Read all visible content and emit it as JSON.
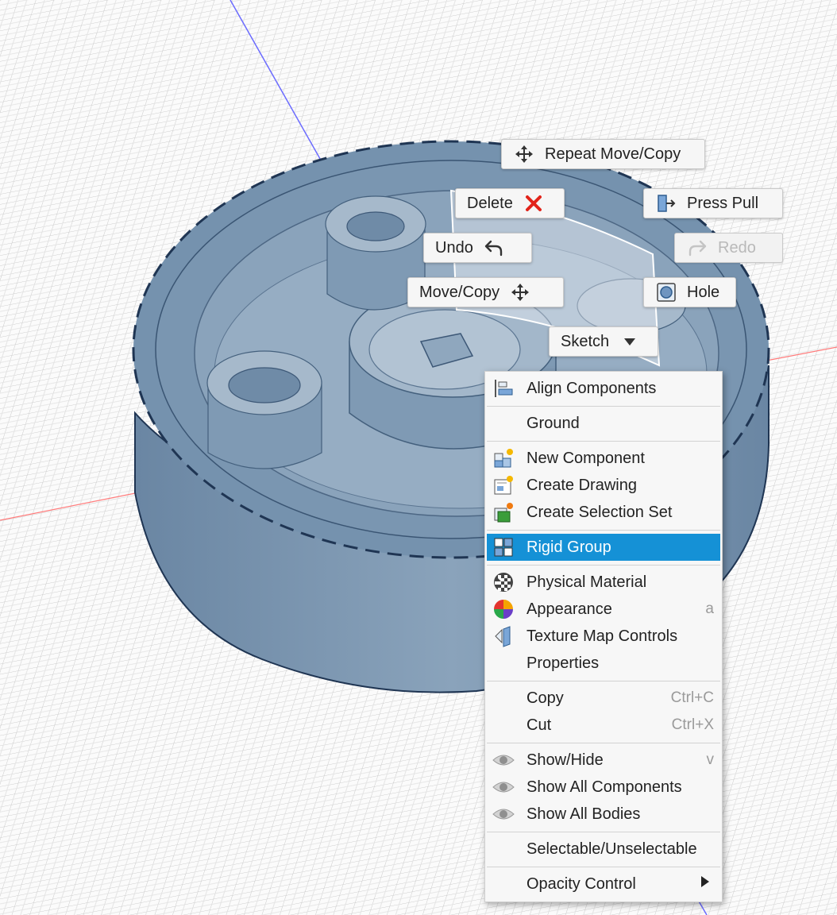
{
  "marking_menu": {
    "repeat_move_copy": "Repeat Move/Copy",
    "delete": "Delete",
    "press_pull": "Press Pull",
    "undo": "Undo",
    "redo": "Redo",
    "move_copy": "Move/Copy",
    "hole": "Hole",
    "sketch": "Sketch"
  },
  "context_menu": {
    "items": [
      {
        "label": "Align Components",
        "icon": "align-components-icon"
      },
      {
        "label": "Ground"
      },
      {
        "label": "New Component",
        "icon": "new-component-icon"
      },
      {
        "label": "Create Drawing",
        "icon": "create-drawing-icon"
      },
      {
        "label": "Create Selection Set",
        "icon": "selection-set-icon"
      },
      {
        "label": "Rigid Group",
        "icon": "rigid-group-icon",
        "highlighted": true
      },
      {
        "label": "Physical Material",
        "icon": "physical-material-icon"
      },
      {
        "label": "Appearance",
        "icon": "appearance-icon",
        "shortcut": "a"
      },
      {
        "label": "Texture Map Controls",
        "icon": "texture-map-icon"
      },
      {
        "label": "Properties"
      },
      {
        "label": "Copy",
        "shortcut": "Ctrl+C"
      },
      {
        "label": "Cut",
        "shortcut": "Ctrl+X"
      },
      {
        "label": "Show/Hide",
        "icon": "eye-icon",
        "shortcut": "v"
      },
      {
        "label": "Show All Components",
        "icon": "eye-icon"
      },
      {
        "label": "Show All Bodies",
        "icon": "eye-icon"
      },
      {
        "label": "Selectable/Unselectable"
      },
      {
        "label": "Opacity Control",
        "icon": "submenu-arrow-icon"
      }
    ]
  },
  "colors": {
    "highlight": "#1591d6",
    "gear": "#6d8aa6",
    "delete_x": "#e2231a"
  }
}
